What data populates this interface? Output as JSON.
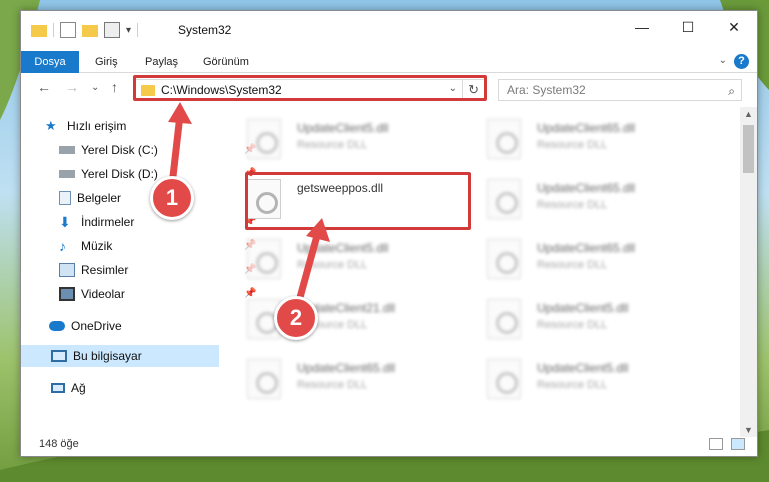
{
  "window": {
    "title": "System32"
  },
  "ribbon": {
    "tabs": [
      "Dosya",
      "Giriş",
      "Paylaş",
      "Görünüm"
    ]
  },
  "address": {
    "path": "C:\\Windows\\System32"
  },
  "search": {
    "placeholder": "Ara: System32"
  },
  "sidebar": {
    "quick_access": "Hızlı erişim",
    "items": [
      {
        "label": "Yerel Disk (C:)",
        "icon": "drive-icon"
      },
      {
        "label": "Yerel Disk (D:)",
        "icon": "drive-icon"
      },
      {
        "label": "Belgeler",
        "icon": "documents-icon"
      },
      {
        "label": "İndirmeler",
        "icon": "downloads-icon"
      },
      {
        "label": "Müzik",
        "icon": "music-icon"
      },
      {
        "label": "Resimler",
        "icon": "pictures-icon"
      },
      {
        "label": "Videolar",
        "icon": "videos-icon"
      }
    ],
    "onedrive": "OneDrive",
    "this_pc": "Bu bilgisayar",
    "network": "Ağ"
  },
  "files": [
    {
      "name": "UpdateClient5.dll",
      "type": "Resource DLL"
    },
    {
      "name": "UpdateClient65.dll",
      "type": "Resource DLL"
    },
    {
      "name": "getsweeppos.dll",
      "type": ""
    },
    {
      "name": "UpdateClient65.dll",
      "type": "Resource DLL"
    },
    {
      "name": "UpdateClient5.dll",
      "type": "Resource DLL"
    },
    {
      "name": "UpdateClient65.dll",
      "type": "Resource DLL"
    },
    {
      "name": "UpdateClient21.dll",
      "type": "Resource DLL"
    },
    {
      "name": "UpdateClient5.dll",
      "type": "Resource DLL"
    },
    {
      "name": "UpdateClient65.dll",
      "type": "Resource DLL"
    },
    {
      "name": "UpdateClient5.dll",
      "type": "Resource DLL"
    }
  ],
  "status": {
    "count": "148 öğe"
  },
  "markers": [
    "1",
    "2"
  ],
  "colors": {
    "accent": "#1979ca",
    "highlight": "#d23a3a",
    "marker": "#e24a4a"
  }
}
